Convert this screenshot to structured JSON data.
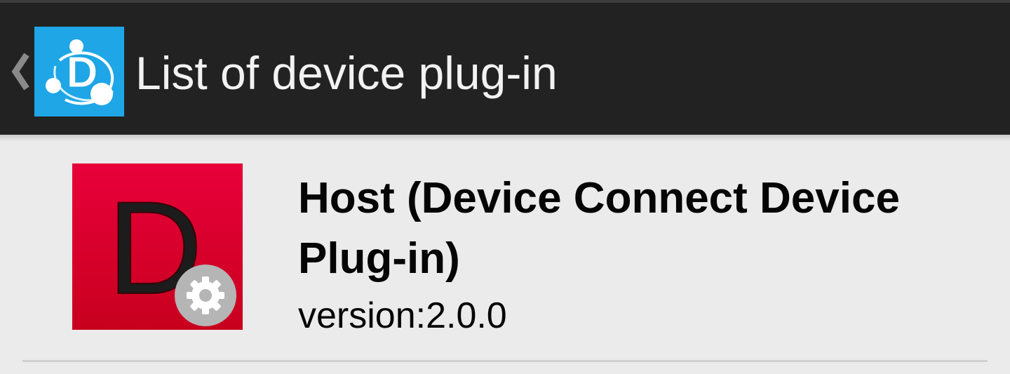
{
  "action_bar": {
    "title": "List of device plug-in",
    "up_icon": "chevron-left-icon",
    "app_icon": "device-connect-logo-icon",
    "logo_letter": "D",
    "background": "#222222",
    "logo_color": "#1ea6e6"
  },
  "plugin_list": {
    "items": [
      {
        "name": "Host (Device Connect Device Plug-in)",
        "version": "version:2.0.0",
        "icon": "host-plugin-icon",
        "icon_letter": "D",
        "icon_color": "#d8002d",
        "badge_icon": "gear-icon"
      }
    ]
  }
}
